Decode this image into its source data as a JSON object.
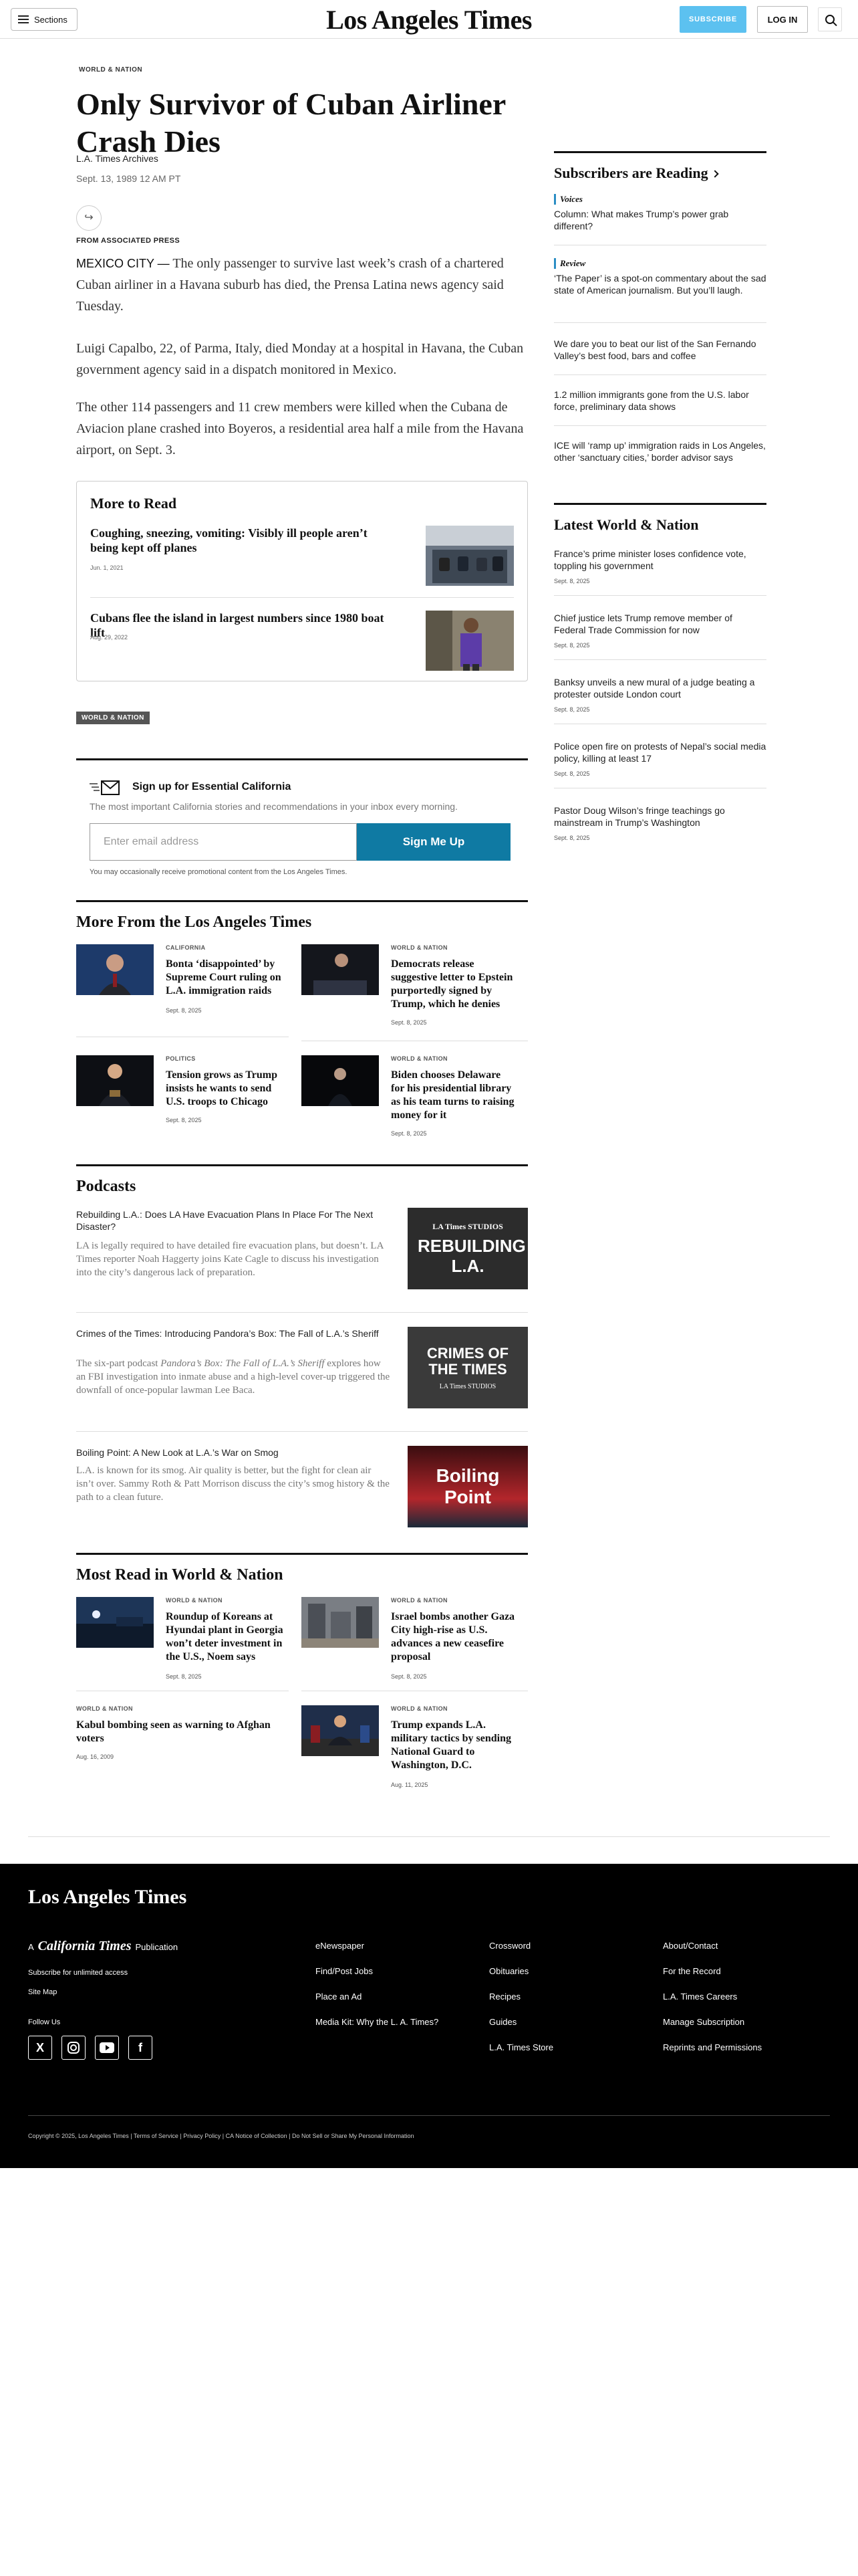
{
  "header": {
    "sections_label": "Sections",
    "logo": "Los Angeles Times",
    "subscribe_label": "SUBSCRIBE",
    "login_label": "LOG IN"
  },
  "article": {
    "kicker": "WORLD & NATION",
    "headline": "Only Survivor of Cuban Airliner Crash Dies",
    "byline": "L.A. Times Archives",
    "date": "Sept. 13, 1989 12 AM PT",
    "source": "FROM ASSOCIATED PRESS",
    "paragraphs": [
      {
        "dateline": "MEXICO CITY —",
        "text": " The only passenger to survive last week’s crash of a chartered Cuban airliner in a Havana suburb has died, the Prensa Latina news agency said Tuesday."
      },
      {
        "text": "Luigi Capalbo, 22, of Parma, Italy, died Monday at a hospital in Havana, the Cuban government agency said in a dispatch monitored in Mexico."
      },
      {
        "text": "The other 114 passengers and 11 crew members were killed when the Cubana de Aviacion plane crashed into Boyeros, a residential area half a mile from the Havana airport, on Sept. 3."
      }
    ],
    "tag": "WORLD & NATION"
  },
  "more_to_read": {
    "title": "More to Read",
    "items": [
      {
        "title": "Coughing, sneezing, vomiting: Visibly ill people aren’t being kept off planes",
        "date": "Jun. 1, 2021"
      },
      {
        "title": "Cubans flee the island in largest numbers since 1980 boat lift",
        "date": "Aug. 29, 2022"
      }
    ]
  },
  "newsletter": {
    "title": "Sign up for Essential California",
    "subtitle": "The most important California stories and recommendations in your inbox every morning.",
    "placeholder": "Enter email address",
    "button": "Sign Me Up",
    "note": "You may occasionally receive promotional content from the Los Angeles Times."
  },
  "more_from": {
    "title": "More From the Los Angeles Times",
    "items": [
      {
        "kicker": "CALIFORNIA",
        "title": "Bonta ‘disappointed’ by Supreme Court ruling on L.A. immigration raids",
        "date": "Sept. 8, 2025"
      },
      {
        "kicker": "WORLD & NATION",
        "title": "Democrats release suggestive letter to Epstein purportedly signed by Trump, which he denies",
        "date": "Sept. 8, 2025"
      },
      {
        "kicker": "POLITICS",
        "title": "Tension grows as Trump insists he wants to send U.S. troops to Chicago",
        "date": "Sept. 8, 2025"
      },
      {
        "kicker": "WORLD & NATION",
        "title": "Biden chooses Delaware for his presidential library as his team turns to raising money for it",
        "date": "Sept. 8, 2025"
      }
    ]
  },
  "podcasts": {
    "title": "Podcasts",
    "items": [
      {
        "title": "Rebuilding L.A.: Does LA Have Evacuation Plans In Place For The Next Disaster?",
        "desc": "LA is legally required to have detailed fire evacuation plans, but doesn’t. LA Times reporter Noah Haggerty joins Kate Cagle to discuss his investigation into the city’s dangerous lack of preparation.",
        "art_top": "LA Times STUDIOS",
        "art_main": "REBUILDING L.A."
      },
      {
        "title": "Crimes of the Times: Introducing Pandora’s Box: The Fall of L.A.’s Sheriff",
        "desc_pre": "The six-part podcast ",
        "desc_em": "Pandora’s Box: The Fall of L.A.’s Sheriff",
        "desc_post": " explores how an FBI investigation into inmate abuse and a high-level cover-up triggered the downfall of once-popular lawman Lee Baca.",
        "art_main": "CRIMES OF THE TIMES",
        "art_bottom": "LA Times STUDIOS"
      },
      {
        "title": "Boiling Point: A New Look at L.A.’s War on Smog",
        "desc": "L.A. is known for its smog. Air quality is better, but the fight for clean air isn’t over. Sammy Roth & Patt Morrison discuss the city’s smog history & the path to a clean future.",
        "art_main": "Boiling Point"
      }
    ]
  },
  "most_read": {
    "title": "Most Read in World & Nation",
    "items": [
      {
        "kicker": "WORLD & NATION",
        "title": "Roundup of Koreans at Hyundai plant in Georgia won’t deter investment in the U.S., Noem says",
        "date": "Sept. 8, 2025"
      },
      {
        "kicker": "WORLD & NATION",
        "title": "Israel bombs another Gaza City high-rise as U.S. advances a new ceasefire proposal",
        "date": "Sept. 8, 2025"
      },
      {
        "kicker": "WORLD & NATION",
        "title": "Kabul bombing seen as warning to Afghan voters",
        "date": "Aug. 16, 2009"
      },
      {
        "kicker": "WORLD & NATION",
        "title": "Trump expands L.A. military tactics by sending National Guard to Washington, D.C.",
        "date": "Aug. 11, 2025"
      }
    ]
  },
  "sidebar": {
    "subscribers_title": "Subscribers are Reading",
    "reading": [
      {
        "label": "Voices",
        "text": "Column: What makes Trump’s power grab different?"
      },
      {
        "label": "Review",
        "text": "‘The Paper’ is a spot-on commentary about the sad state of American journalism. But you’ll laugh."
      },
      {
        "text": "We dare you to beat our list of the San Fernando Valley’s best food, bars and coffee"
      },
      {
        "text": "1.2 million immigrants gone from the U.S. labor force, preliminary data shows"
      },
      {
        "text": "ICE will ‘ramp up’ immigration raids in Los Angeles, other ‘sanctuary cities,’ border advisor says"
      }
    ],
    "latest_title": "Latest World & Nation",
    "latest": [
      {
        "text": "France’s prime minister loses confidence vote, toppling his government",
        "date": "Sept. 8, 2025"
      },
      {
        "text": "Chief justice lets Trump remove member of Federal Trade Commission for now",
        "date": "Sept. 8, 2025"
      },
      {
        "text": "Banksy unveils a new mural of a judge beating a protester outside London court",
        "date": "Sept. 8, 2025"
      },
      {
        "text": "Police open fire on protests of Nepal’s social media policy, killing at least 17",
        "date": "Sept. 8, 2025"
      },
      {
        "text": "Pastor Doug Wilson’s fringe teachings go mainstream in Trump’s Washington",
        "date": "Sept. 8, 2025"
      }
    ]
  },
  "footer": {
    "logo": "Los Angeles Times",
    "pub_prefix": "A",
    "pub_name": "California Times",
    "pub_suffix": "Publication",
    "subscribe": "Subscribe for unlimited access",
    "sitemap": "Site Map",
    "follow": "Follow Us",
    "col1": [
      "eNewspaper",
      "Find/Post Jobs",
      "Place an Ad",
      "Media Kit: Why the L. A. Times?"
    ],
    "col2": [
      "Crossword",
      "Obituaries",
      "Recipes",
      "Guides",
      "L.A. Times Store"
    ],
    "col3": [
      "About/Contact",
      "For the Record",
      "L.A. Times Careers",
      "Manage Subscription",
      "Reprints and Permissions"
    ],
    "copyright": "Copyright © 2025, Los Angeles Times | Terms of Service | Privacy Policy | CA Notice of Collection | Do Not Sell or Share My Personal Information"
  }
}
